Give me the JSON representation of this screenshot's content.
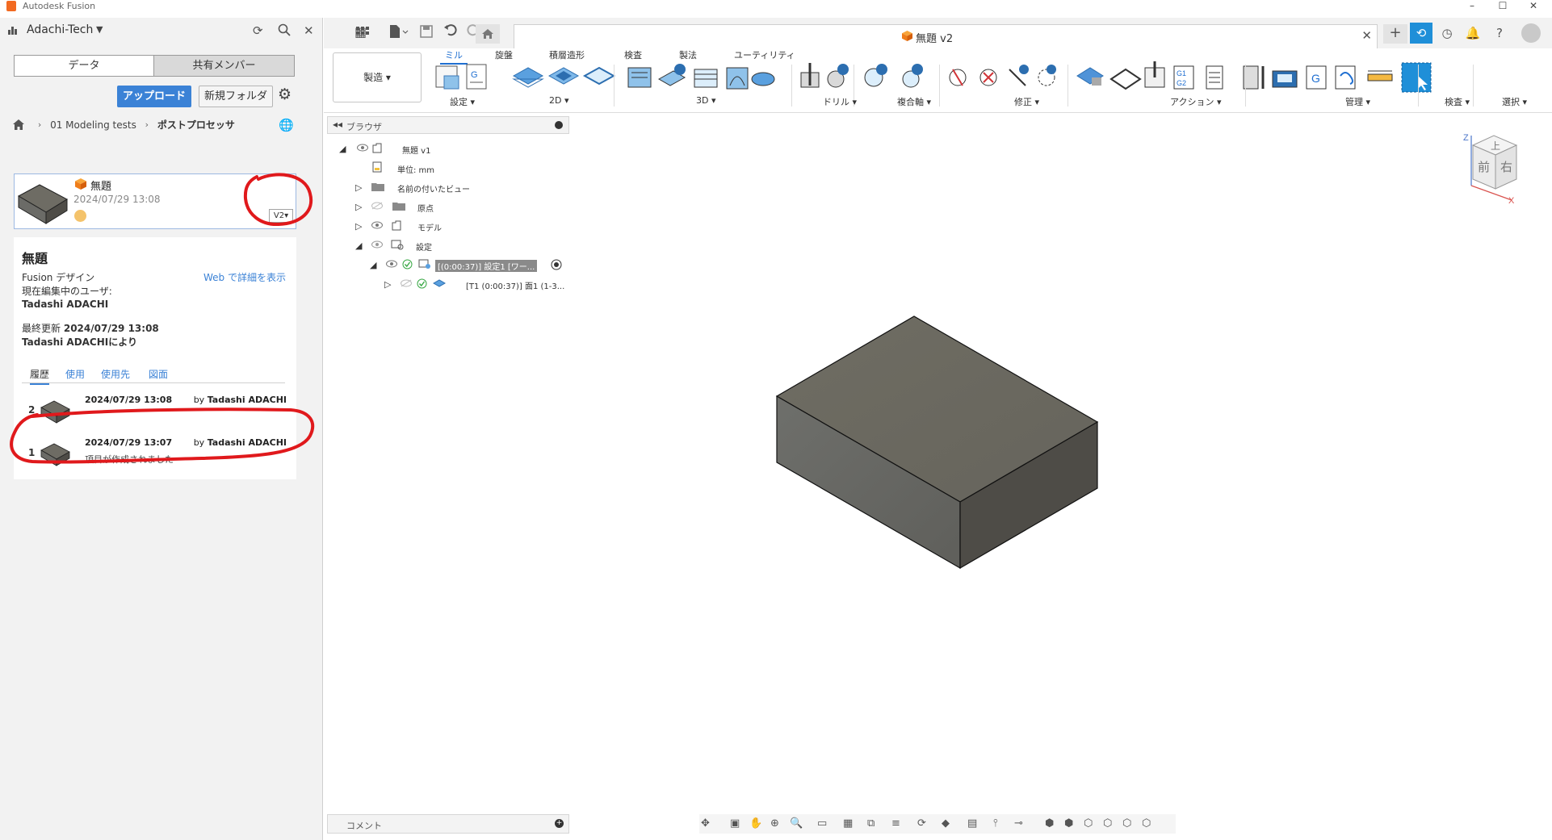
{
  "window": {
    "title": "Autodesk Fusion",
    "controls": [
      "–",
      "☐",
      "✕"
    ]
  },
  "datapanel": {
    "hub_name": "Adachi-Tech",
    "tabs": [
      "データ",
      "共有メンバー"
    ],
    "upload_label": "アップロード",
    "new_folder_label": "新規フォルダ",
    "breadcrumb": [
      "01 Modeling tests",
      "ポストプロセッサ"
    ],
    "file": {
      "name": "無題",
      "date": "2024/07/29 13:08",
      "version": "V2▾"
    },
    "details": {
      "title": "無題",
      "type": "Fusion デザイン",
      "web_link": "Web で詳細を表示",
      "editing_label": "現在編集中のユーザ:",
      "editing_user": "Tadashi ADACHI",
      "last_updated_label": "最終更新",
      "last_updated_date": "2024/07/29 13:08",
      "last_updated_by": "Tadashi ADACHIにより",
      "tabs": [
        "履歴",
        "使用",
        "使用先",
        "図面"
      ],
      "versions": [
        {
          "num": "2",
          "date": "2024/07/29 13:08",
          "by_prefix": "by",
          "by_name": "Tadashi ADACHI",
          "note": ""
        },
        {
          "num": "1",
          "date": "2024/07/29 13:07",
          "by_prefix": "by",
          "by_name": "Tadashi ADACHI",
          "note": "項目が作成されました"
        }
      ]
    }
  },
  "document": {
    "tab_title": "無題 v2"
  },
  "ribbon": {
    "workspace": "製造 ▾",
    "tabs": [
      "ミル",
      "旋盤",
      "積層造形",
      "検査",
      "製法",
      "ユーティリティ"
    ],
    "groups": [
      "設定 ▾",
      "2D ▾",
      "3D ▾",
      "ドリル ▾",
      "複合軸 ▾",
      "修正 ▾",
      "アクション ▾",
      "管理 ▾",
      "検査 ▾",
      "選択 ▾"
    ]
  },
  "browser": {
    "title": "ブラウザ",
    "nodes": [
      {
        "label": "無題 v1"
      },
      {
        "label": "単位: mm"
      },
      {
        "label": "名前の付いたビュー"
      },
      {
        "label": "原点"
      },
      {
        "label": "モデル"
      },
      {
        "label": "設定"
      },
      {
        "label": "[(0:00:37)] 設定1 [ワー..."
      },
      {
        "label": "[T1 (0:00:37)] 面1 (1-3..."
      }
    ]
  },
  "viewcube": {
    "top": "上",
    "front": "前",
    "right": "右",
    "z": "Z",
    "x": "X"
  },
  "comments": {
    "label": "コメント"
  },
  "colors": {
    "accent": "#3b82d6",
    "annotation": "#e0191c",
    "box_top": "#6d6b62",
    "box_left": "#6a6a66",
    "box_right": "#4d4b46"
  }
}
